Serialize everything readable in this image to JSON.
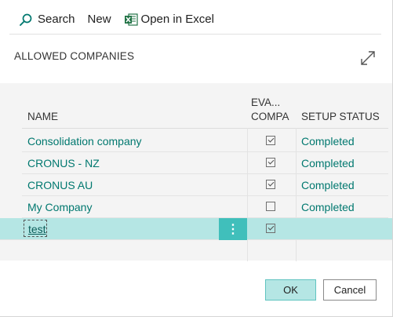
{
  "toolbar": {
    "search_label": "Search",
    "new_label": "New",
    "excel_label": "Open in Excel"
  },
  "page": {
    "title": "ALLOWED COMPANIES"
  },
  "columns": {
    "name": "NAME",
    "evaluation_line1": "EVA...",
    "evaluation_line2": "COMPA",
    "setup_status": "SETUP STATUS"
  },
  "rows": [
    {
      "name": "Consolidation company",
      "evaluation": true,
      "status": "Completed"
    },
    {
      "name": "CRONUS - NZ",
      "evaluation": true,
      "status": "Completed"
    },
    {
      "name": "CRONUS AU",
      "evaluation": true,
      "status": "Completed"
    },
    {
      "name": "My Company",
      "evaluation": false,
      "status": "Completed"
    }
  ],
  "selected_row": {
    "name": "test",
    "evaluation": true,
    "status": "",
    "menu_glyph": "⋮"
  },
  "footer": {
    "ok_label": "OK",
    "cancel_label": "Cancel"
  },
  "colors": {
    "accent_teal": "#00786f",
    "selected_row": "#b5e6e4",
    "row_menu": "#40bfbb",
    "excel_green": "#217346"
  },
  "icons": {
    "search": "search-icon",
    "excel": "excel-icon",
    "expand": "expand-icon"
  }
}
